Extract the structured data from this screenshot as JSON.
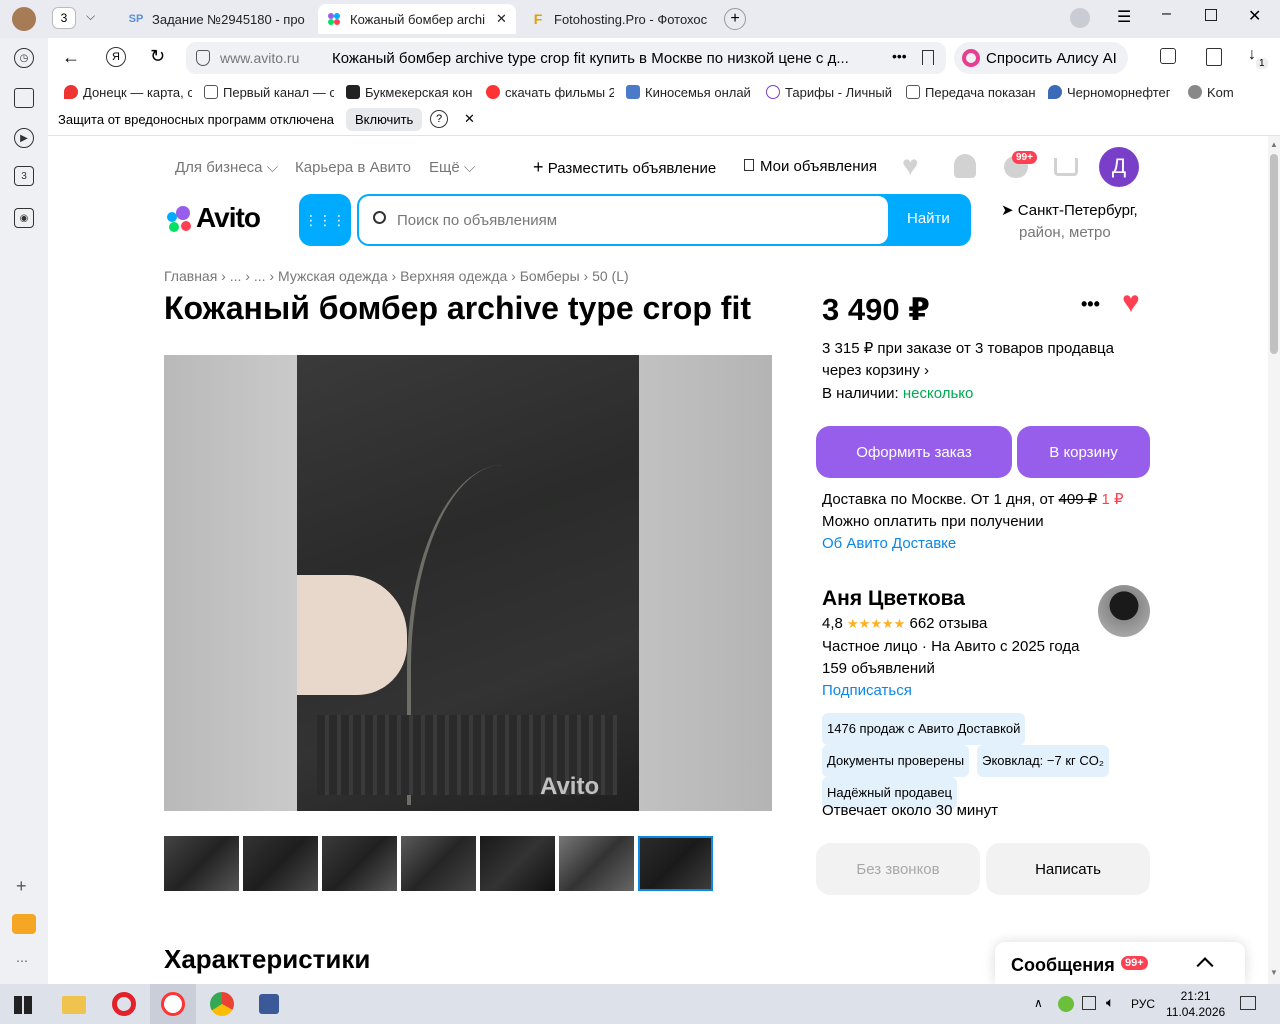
{
  "browser": {
    "tab_count": "3",
    "tabs": [
      {
        "label": "Задание №2945180 - про",
        "icon": "SP"
      },
      {
        "label": "Кожаный бомбер archi",
        "icon": "avito"
      },
      {
        "label": "Fotohosting.Pro - Фотохос",
        "icon": "F"
      }
    ],
    "address_domain": "www.avito.ru",
    "address_title": "Кожаный бомбер archive type crop fit купить в Москве по низкой цене с д...",
    "alice_label": "Спросить Алису AI",
    "download_badge": "1",
    "bookmarks": [
      "Донецк — карта, с",
      "Первый канал — с",
      "Букмекерская кон",
      "скачать фильмы 2",
      "Киносемья онлай",
      "Тарифы - Личный",
      "Передача показан",
      "Черноморнефтег",
      "Kom"
    ],
    "protection_text": "Защита от вредоносных программ отключена",
    "protection_button": "Включить",
    "sidebar_badge": "3"
  },
  "header": {
    "for_business": "Для бизнеса",
    "career": "Карьера в Авито",
    "more": "Ещё",
    "post_ad": "Разместить объявление",
    "my_ads": "Мои объявления",
    "messages_badge": "99+",
    "avatar_letter": "Д",
    "logo": "Avito",
    "search_placeholder": "Поиск по объявлениям",
    "search_button": "Найти",
    "city": "Санкт-Петербург,",
    "city_sub": "район, метро"
  },
  "breadcrumbs": [
    "Главная",
    "...",
    "...",
    "Мужская одежда",
    "Верхняя одежда",
    "Бомберы",
    "50 (L)"
  ],
  "title": "Кожаный бомбер archive type crop fit",
  "gallery": {
    "watermark": "Avito",
    "thumbnails": 7
  },
  "price": {
    "value": "3 490 ₽",
    "bulk_line1": "3 315 ₽ при заказе от 3 товаров продавца",
    "bulk_line2": "через корзину",
    "stock_label": "В наличии:",
    "stock_value": "несколько",
    "order_button": "Оформить заказ",
    "cart_button": "В корзину",
    "delivery_text": "Доставка по Москве. От 1 дня, от",
    "delivery_old": "409 ₽",
    "delivery_new": "1 ₽",
    "payment": "Можно оплатить при получении",
    "about_delivery": "Об Авито Доставке"
  },
  "seller": {
    "name": "Аня Цветкова",
    "rating": "4,8",
    "stars": "★★★★★",
    "reviews": "662 отзыва",
    "info": "Частное лицо · На Авито с 2025 года",
    "ads": "159 объявлений",
    "subscribe": "Подписаться",
    "chips": [
      "1476 продаж с Авито Доставкой",
      "Документы проверены",
      "Эковклад: −7 кг CO₂",
      "Надёжный продавец"
    ],
    "response": "Отвечает около 30 минут",
    "no_calls": "Без звонков",
    "write": "Написать"
  },
  "characteristics": "Характеристики",
  "messenger": {
    "label": "Сообщения",
    "badge": "99+"
  },
  "taskbar": {
    "lang": "РУС",
    "time": "21:21",
    "date": "11.04.2026"
  },
  "colors": {
    "accent": "#965eeb",
    "avito_blue": "#00aaff",
    "link": "#0a88e8",
    "green": "#02d15c",
    "heart": "#ff4053"
  }
}
